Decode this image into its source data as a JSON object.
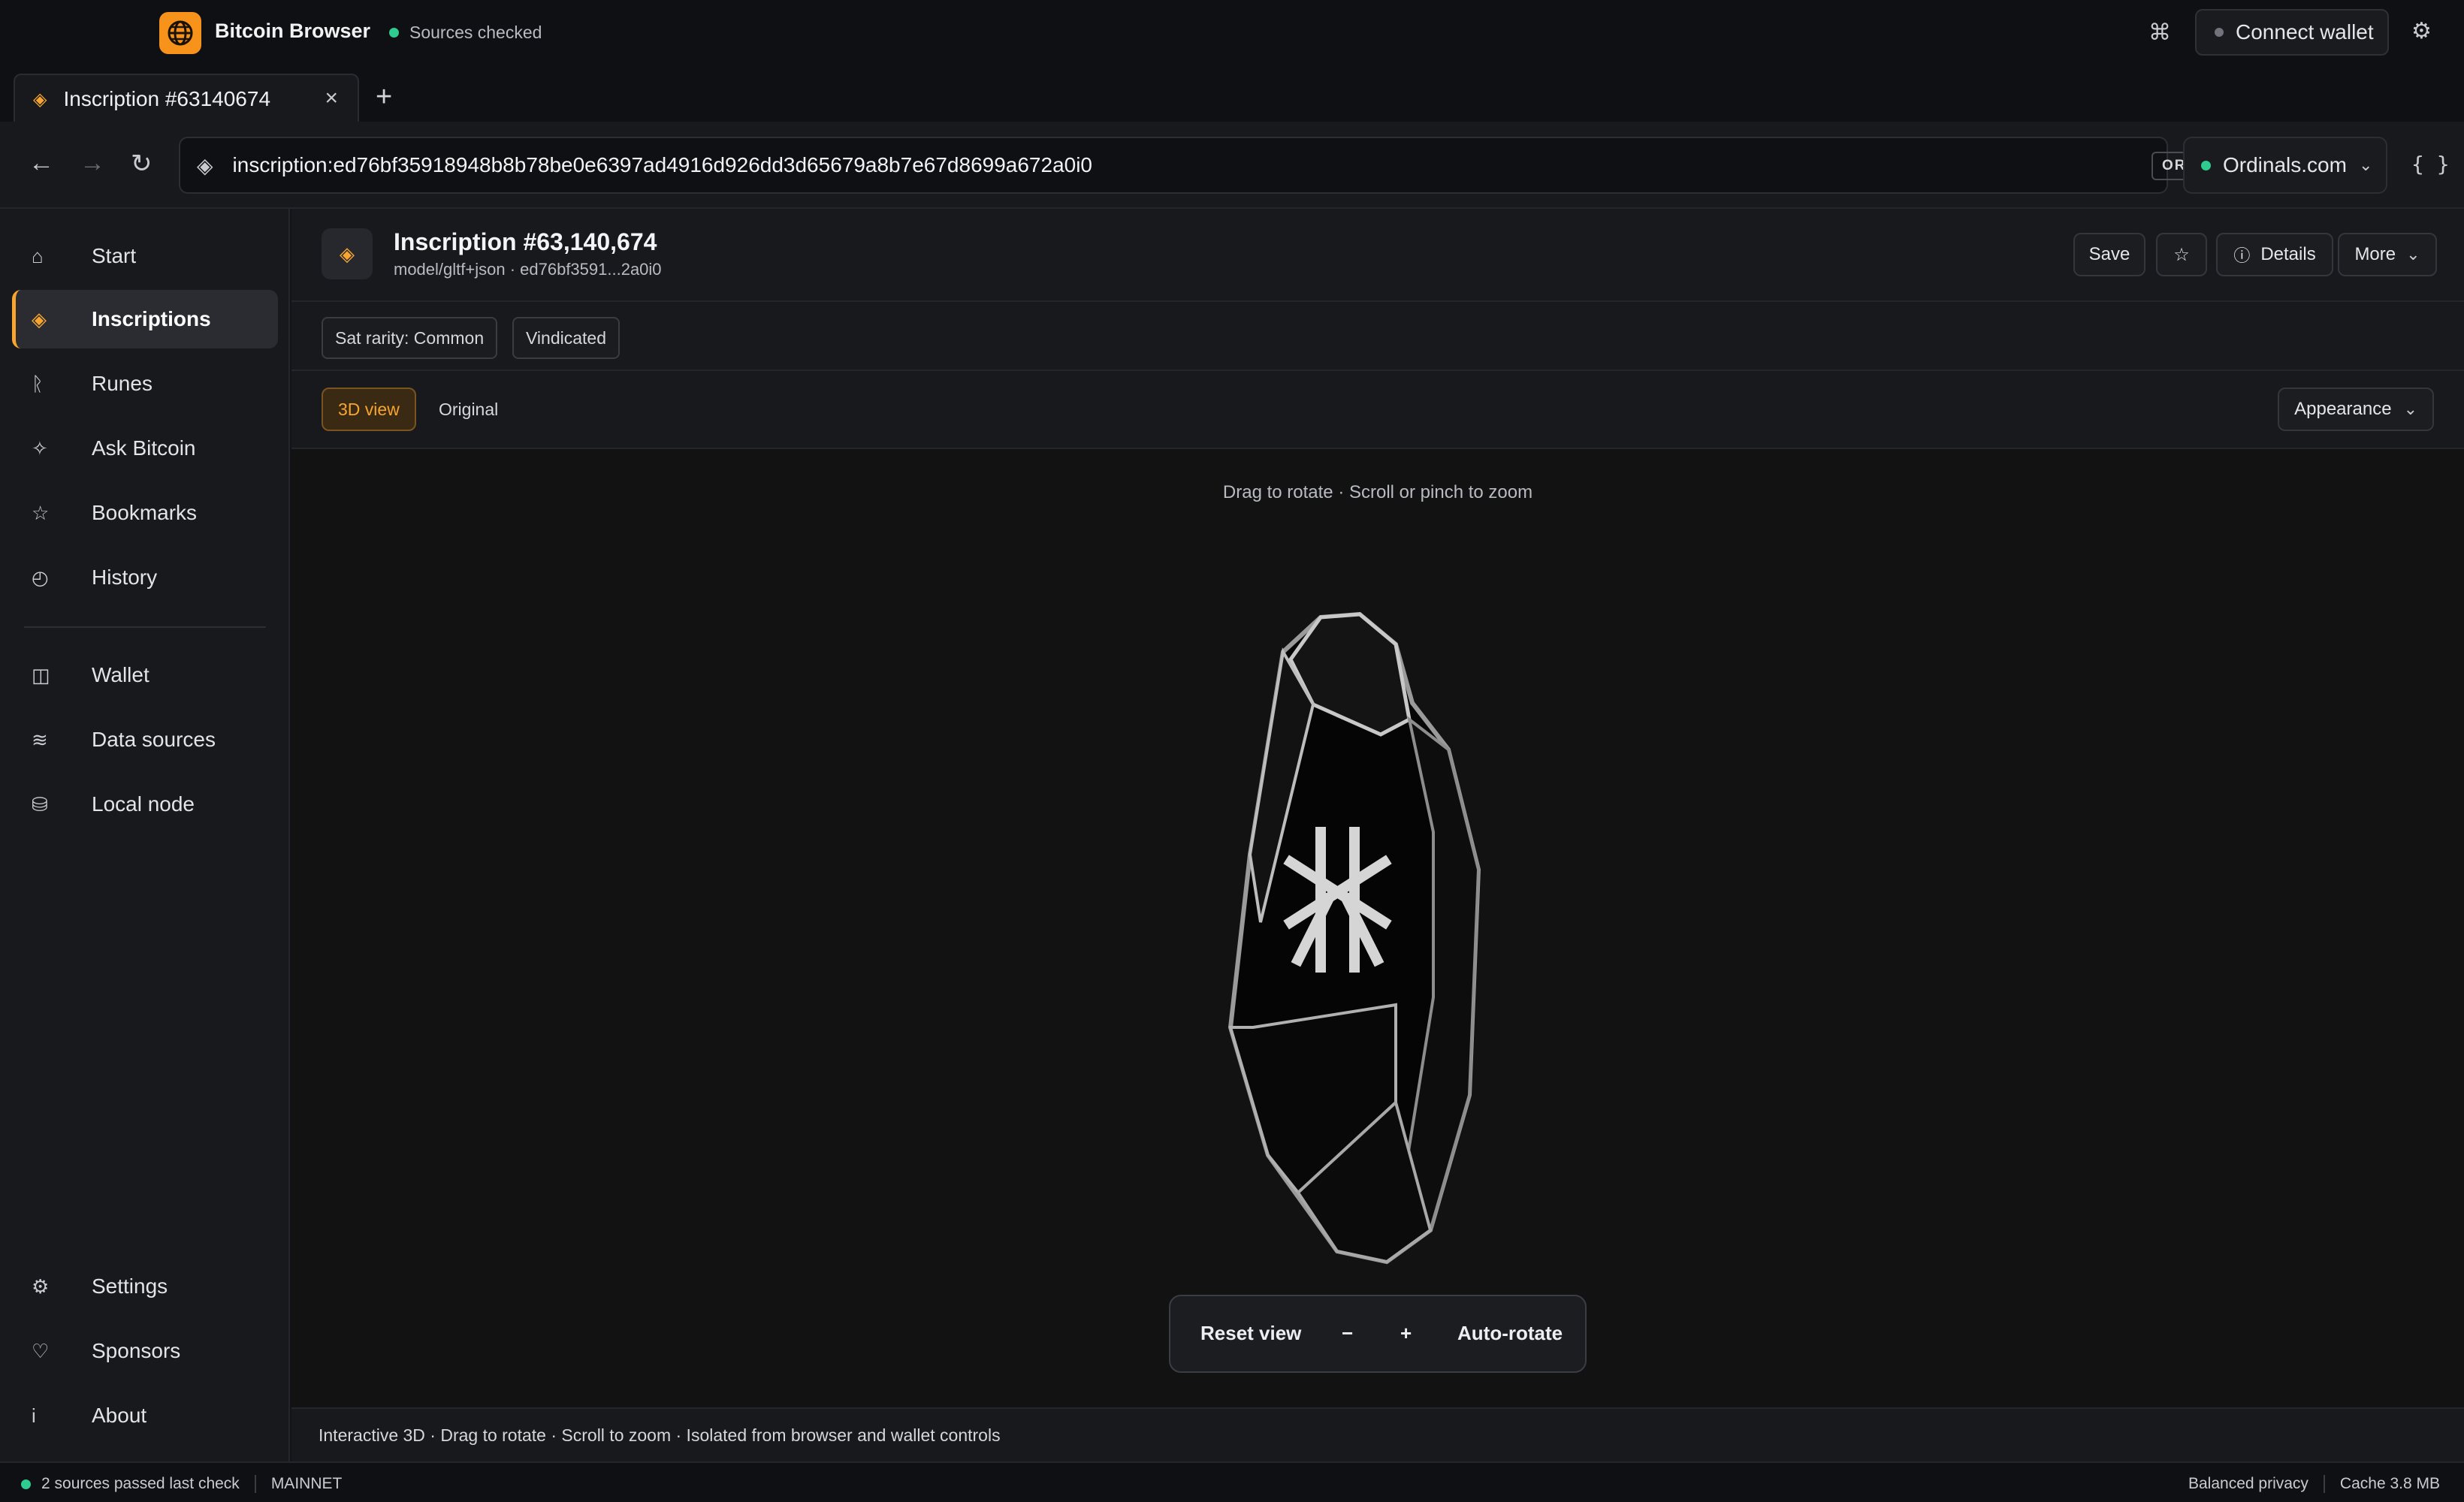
{
  "app": {
    "name": "Bitcoin Browser",
    "sources_status": "Sources checked",
    "connect_wallet": "Connect wallet",
    "accent": "#f7931a",
    "status_green": "#2ecc8f"
  },
  "tabs": [
    {
      "title": "Inscription #63140674",
      "icon": "inscription-diamond-icon"
    }
  ],
  "nav": {
    "address": "inscription:ed76bf35918948b8b78be0e6397ad4916d926dd3d65679a8b7e67d8699a672a0i0",
    "source_tag": "ORDINALS.COM",
    "provider": "Ordinals.com",
    "json_label": "{ }"
  },
  "sidebar": {
    "items": [
      {
        "label": "Start",
        "icon": "home-icon"
      },
      {
        "label": "Inscriptions",
        "icon": "diamond-icon",
        "active": true
      },
      {
        "label": "Runes",
        "icon": "rune-icon"
      },
      {
        "label": "Ask Bitcoin",
        "icon": "sparkle-icon"
      },
      {
        "label": "Bookmarks",
        "icon": "star-icon"
      },
      {
        "label": "History",
        "icon": "clock-icon"
      }
    ],
    "items2": [
      {
        "label": "Wallet",
        "icon": "wallet-icon"
      },
      {
        "label": "Data sources",
        "icon": "waves-icon"
      },
      {
        "label": "Local node",
        "icon": "database-icon"
      }
    ],
    "bottom": [
      {
        "label": "Settings",
        "icon": "gear-icon"
      },
      {
        "label": "Sponsors",
        "icon": "heart-icon"
      },
      {
        "label": "About",
        "icon": "info-icon"
      }
    ]
  },
  "inscription": {
    "title": "Inscription #63,140,674",
    "subtitle": "model/gltf+json · ed76bf3591...2a0i0",
    "actions": {
      "save": "Save",
      "details": "Details",
      "more": "More"
    },
    "tags": [
      "Sat rarity: Common",
      "Vindicated"
    ]
  },
  "view": {
    "tabs": [
      "3D view",
      "Original"
    ],
    "active_tab": "3D view",
    "appearance": "Appearance",
    "hint": "Drag to rotate · Scroll or pinch to zoom",
    "controls": {
      "reset": "Reset view",
      "zoom_out": "−",
      "zoom_in": "+",
      "auto_rotate": "Auto-rotate"
    },
    "info": "Interactive 3D · Drag to rotate · Scroll to zoom · Isolated from browser and wallet controls"
  },
  "status": {
    "sources": "2 sources passed last check",
    "network": "MAINNET",
    "privacy": "Balanced privacy",
    "cache": "Cache 3.8 MB"
  }
}
